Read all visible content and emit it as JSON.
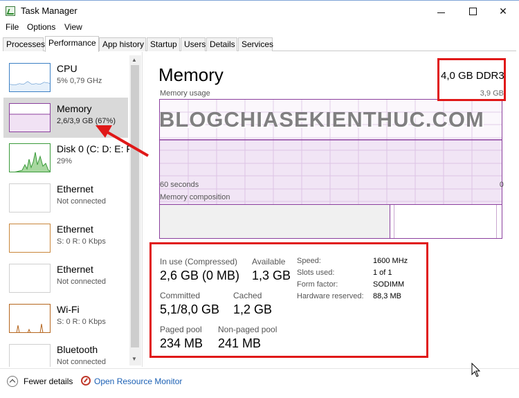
{
  "window": {
    "title": "Task Manager"
  },
  "menu": [
    "File",
    "Options",
    "View"
  ],
  "tabs": [
    "Processes",
    "Performance",
    "App history",
    "Startup",
    "Users",
    "Details",
    "Services"
  ],
  "sidebar": {
    "items": [
      {
        "title": "CPU",
        "sub": "5% 0,79 GHz"
      },
      {
        "title": "Memory",
        "sub": "2,6/3,9 GB (67%)"
      },
      {
        "title": "Disk 0 (C: D: E: F",
        "sub": "29%"
      },
      {
        "title": "Ethernet",
        "sub": "Not connected"
      },
      {
        "title": "Ethernet",
        "sub": "S: 0 R: 0 Kbps"
      },
      {
        "title": "Ethernet",
        "sub": "Not connected"
      },
      {
        "title": "Wi-Fi",
        "sub": "S: 0 R: 0 Kbps"
      },
      {
        "title": "Bluetooth",
        "sub": "Not connected"
      }
    ]
  },
  "memory": {
    "title": "Memory",
    "type": "4,0 GB DDR3",
    "total": "3,9 GB",
    "usage_label": "Memory usage",
    "time_label": "60 seconds",
    "zero_label": "0",
    "composition_label": "Memory composition",
    "stats": {
      "in_use_label": "In use (Compressed)",
      "in_use": "2,6 GB (0 MB)",
      "available_label": "Available",
      "available": "1,3 GB",
      "committed_label": "Committed",
      "committed": "5,1/8,0 GB",
      "cached_label": "Cached",
      "cached": "1,2 GB",
      "paged_label": "Paged pool",
      "paged": "234 MB",
      "nonpaged_label": "Non-paged pool",
      "nonpaged": "241 MB"
    },
    "details": [
      {
        "k": "Speed:",
        "v": "1600 MHz"
      },
      {
        "k": "Slots used:",
        "v": "1 of 1"
      },
      {
        "k": "Form factor:",
        "v": "SODIMM"
      },
      {
        "k": "Hardware reserved:",
        "v": "88,3 MB"
      }
    ]
  },
  "footer": {
    "fewer": "Fewer details",
    "resmon": "Open Resource Monitor"
  },
  "watermark": "BLOGCHIASEKIENTHUC.COM",
  "colors": {
    "memory_accent": "#8b3f9e",
    "cpu_accent": "#3b7fc4",
    "disk_accent": "#3a9a3a",
    "highlight": "#e01818",
    "wifi_accent": "#b5651d"
  }
}
